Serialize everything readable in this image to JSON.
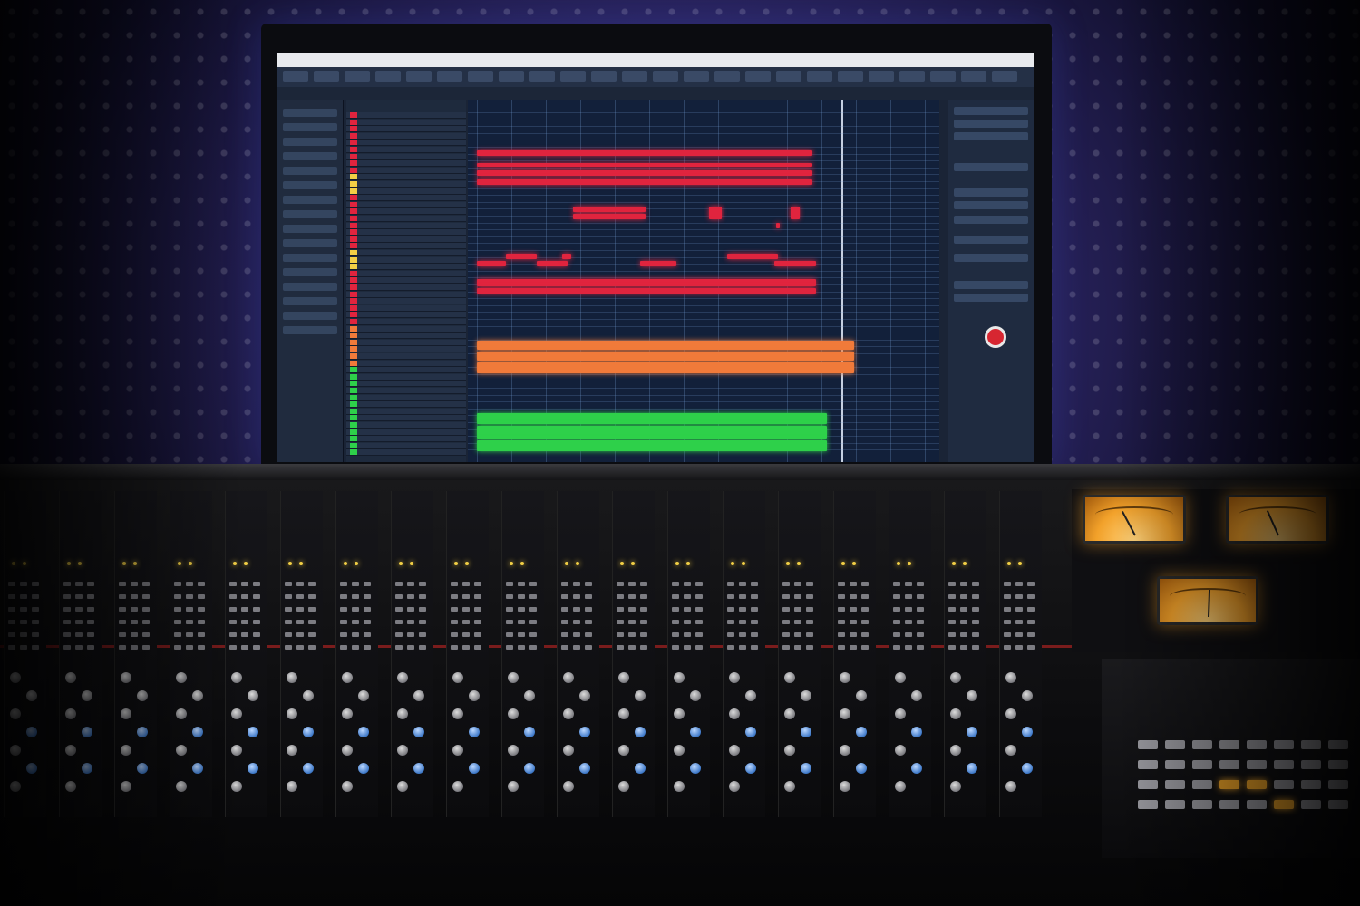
{
  "scene": {
    "description_free": true,
    "accent_colors": {
      "midi_red": "#e0243e",
      "audio_orange": "#f07a3a",
      "audio_green": "#2ed04a",
      "led_yellow": "#f2cf45",
      "vu_amber": "#f2a12a",
      "backdrop_purple": "#4a3f86"
    }
  },
  "daw": {
    "window_present": true,
    "record_button_icon": "record-icon",
    "track_color_codes": [
      "#e0243e",
      "#e0243e",
      "#e0243e",
      "#f2cf45",
      "#e0243e",
      "#e0243e",
      "#e0243e",
      "#f2cf45",
      "#e0243e",
      "#e0243e",
      "#e0243e",
      "#f07a3a",
      "#f07a3a",
      "#2ed04a",
      "#2ed04a",
      "#2ed04a",
      "#2ed04a",
      "#2ed04a"
    ]
  },
  "console": {
    "channel_strip_count": 19,
    "vu_meter_count": 3
  }
}
